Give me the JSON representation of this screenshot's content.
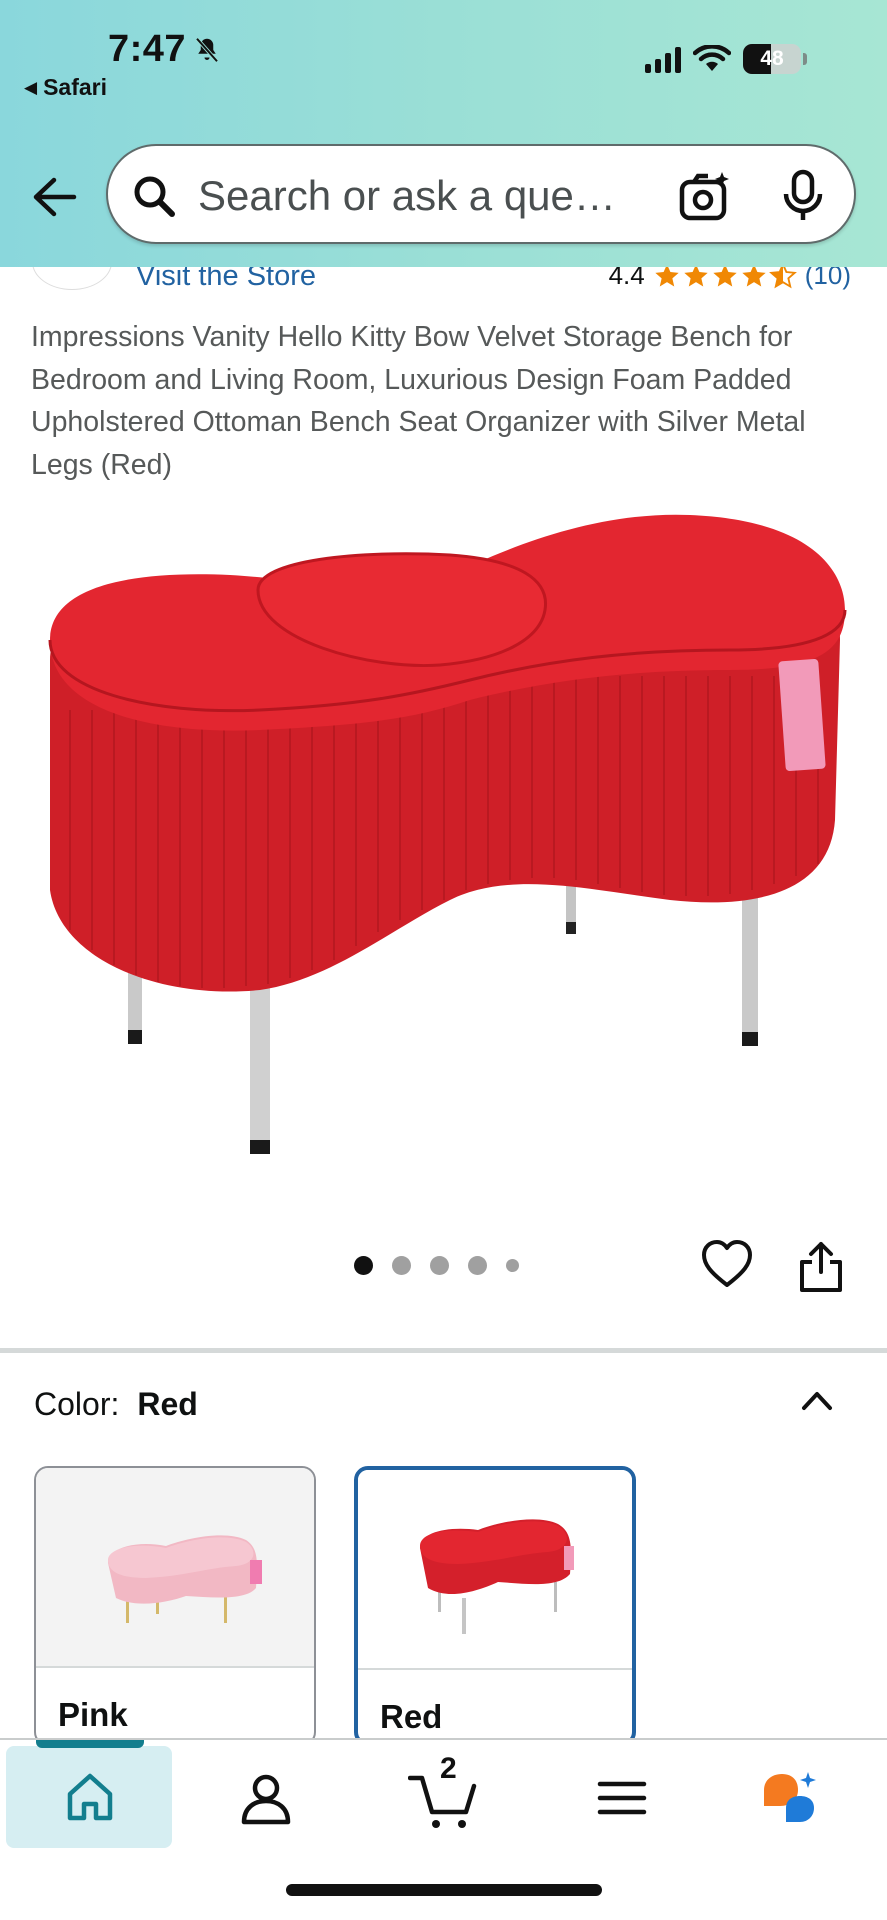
{
  "status_bar": {
    "time": "7:47",
    "back_app": "Safari",
    "battery": "48"
  },
  "search": {
    "placeholder": "Search or ask a que…"
  },
  "store": {
    "visit_label": "Visit the Store",
    "rating_value": "4.4",
    "rating_count": "(10)",
    "stars": 4.5
  },
  "product": {
    "title": "Impressions Vanity Hello Kitty Bow Velvet Storage Bench for Bedroom and Living Room, Luxurious Design Foam Padded Upholstered Ottoman Bench Seat Organizer with Silver Metal Legs (Red)",
    "image_count": 5,
    "active_image": 1
  },
  "color_selector": {
    "label": "Color:",
    "selected": "Red",
    "options": [
      {
        "name": "Pink",
        "color": "#f2b8c4"
      },
      {
        "name": "Red",
        "color": "#d4202b"
      }
    ]
  },
  "bottom_nav": {
    "cart_count": "2",
    "items": [
      "home-icon",
      "account-icon",
      "cart-icon",
      "menu-icon",
      "rufus-icon"
    ]
  },
  "colors": {
    "link": "#2162a1",
    "star": "#f08804",
    "home_active": "#137e8e"
  }
}
